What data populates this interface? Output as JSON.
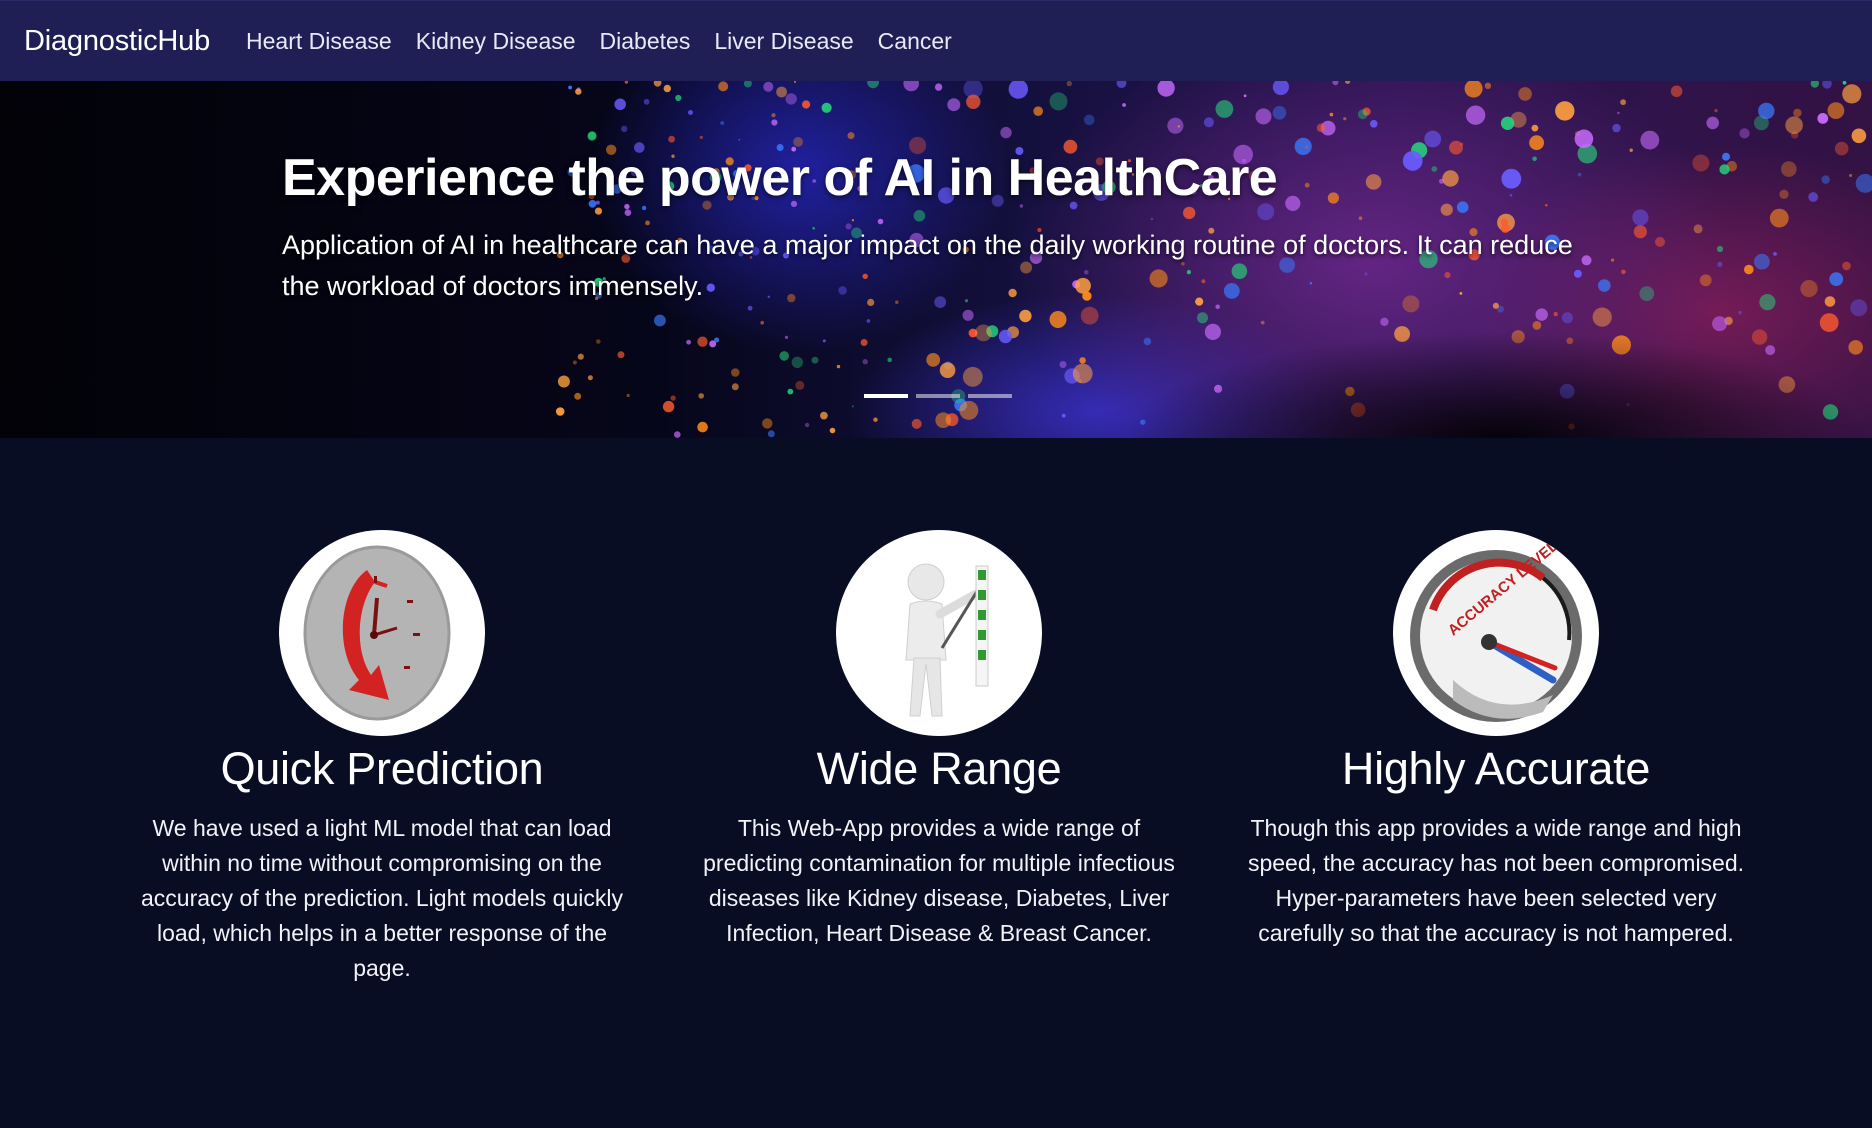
{
  "navbar": {
    "brand": "DiagnosticHub",
    "links": [
      "Heart Disease",
      "Kidney Disease",
      "Diabetes",
      "Liver Disease",
      "Cancer"
    ]
  },
  "hero": {
    "title": "Experience the power of AI in HealthCare",
    "subtitle": "Application of AI in healthcare can have a major impact on the daily working routine of doctors. It can reduce the workload of doctors immensely.",
    "slides_count": 3,
    "active_slide": 1
  },
  "features": [
    {
      "title": "Quick Prediction",
      "text": "We have used a light ML model that can load within no time without compromising on the accuracy of the prediction. Light models quickly load, which helps in a better response of the page.",
      "icon": "clock-icon"
    },
    {
      "title": "Wide Range",
      "text": "This Web-App provides a wide range of predicting contamination for multiple infectious diseases like Kidney disease, Diabetes, Liver Infection, Heart Disease & Breast Cancer.",
      "icon": "checklist-figure-icon"
    },
    {
      "title": "Highly Accurate",
      "text": "Though this app provides a wide range and high speed, the accuracy has not been compromised. Hyper-parameters have been selected very carefully so that the accuracy is not hampered.",
      "icon": "accuracy-gauge-icon",
      "gauge_text": "ACCURACY LEVEL"
    }
  ],
  "colors": {
    "navbar_bg": "#1f1e55",
    "page_bg": "#080d24",
    "text": "#ffffff"
  }
}
